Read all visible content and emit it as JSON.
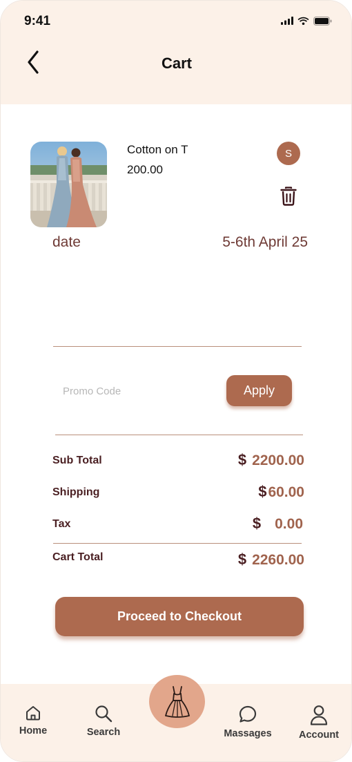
{
  "status_bar": {
    "time": "9:41"
  },
  "header": {
    "title": "Cart"
  },
  "cart_item": {
    "name": "Cotton on T",
    "price": "200.00",
    "size": "S",
    "date_label": "date",
    "date_value": "5-6th April 25"
  },
  "promo": {
    "placeholder": "Promo Code",
    "apply_label": "Apply"
  },
  "summary": {
    "currency": "$",
    "subtotal_label": "Sub Total",
    "subtotal_value": "2200.00",
    "shipping_label": "Shipping",
    "shipping_value": "60.00",
    "tax_label": "Tax",
    "tax_value": "0.00",
    "total_label": "Cart Total",
    "total_value": "2260.00"
  },
  "checkout_label": "Proceed to Checkout",
  "tabs": [
    {
      "label": "Home",
      "icon": "home-icon"
    },
    {
      "label": "Search",
      "icon": "search-icon"
    },
    {
      "label": "",
      "icon": "dress-icon"
    },
    {
      "label": "Massages",
      "icon": "message-icon"
    },
    {
      "label": "Account",
      "icon": "user-icon"
    }
  ],
  "colors": {
    "accent": "#ad6a4f",
    "header_bg": "#fcf1e8",
    "dark_text": "#4a1f22",
    "value_text": "#a0634d"
  }
}
